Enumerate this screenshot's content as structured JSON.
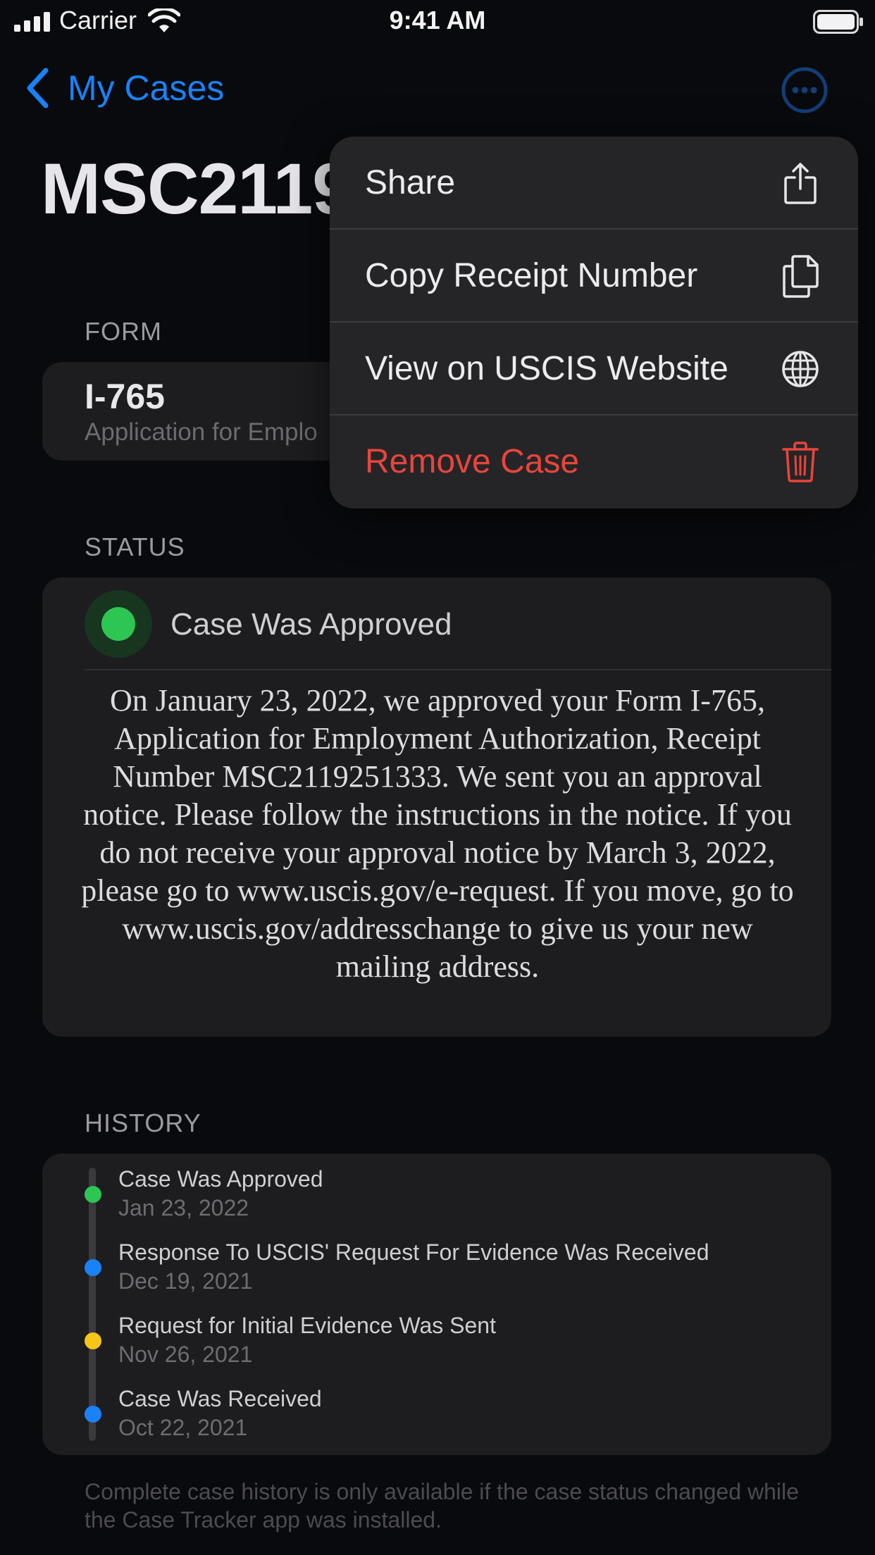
{
  "status_bar": {
    "carrier": "Carrier",
    "time": "9:41 AM"
  },
  "nav": {
    "back_label": "My Cases"
  },
  "page_title": "MSC2119",
  "form_section": {
    "label": "FORM",
    "form_number": "I-765",
    "form_description": "Application for Emplo"
  },
  "status_section": {
    "label": "STATUS",
    "title": "Case Was Approved",
    "body": "On January 23, 2022, we approved your Form I-765, Application for Employment Authorization, Receipt Number MSC2119251333. We sent you an approval notice. Please follow the instructions in the notice. If you do not receive your approval notice by March 3, 2022, please go to www.uscis.gov/e-request. If you move, go to www.uscis.gov/addresschange to give us your new mailing address.",
    "status_color": "#2dc653"
  },
  "history_section": {
    "label": "HISTORY",
    "events": [
      {
        "title": "Case Was Approved",
        "date": "Jan 23, 2022",
        "color": "#2dc653"
      },
      {
        "title": "Response To USCIS' Request For Evidence Was Received",
        "date": "Dec 19, 2021",
        "color": "#1a82f7"
      },
      {
        "title": "Request for Initial Evidence Was Sent",
        "date": "Nov 26, 2021",
        "color": "#f5c518"
      },
      {
        "title": "Case Was Received",
        "date": "Oct 22, 2021",
        "color": "#1a82f7"
      }
    ]
  },
  "footer_note": "Complete case history is only available if the case status changed while the Case Tracker app was installed.",
  "context_menu": {
    "items": [
      {
        "label": "Share",
        "icon": "share-icon"
      },
      {
        "label": "Copy Receipt Number",
        "icon": "copy-icon"
      },
      {
        "label": "View on USCIS Website",
        "icon": "globe-icon"
      },
      {
        "label": "Remove Case",
        "icon": "trash-icon",
        "destructive": true
      }
    ]
  },
  "colors": {
    "accent": "#1a82f7",
    "destructive": "#e8453c",
    "background": "#090a0e",
    "card": "#1d1d20"
  }
}
